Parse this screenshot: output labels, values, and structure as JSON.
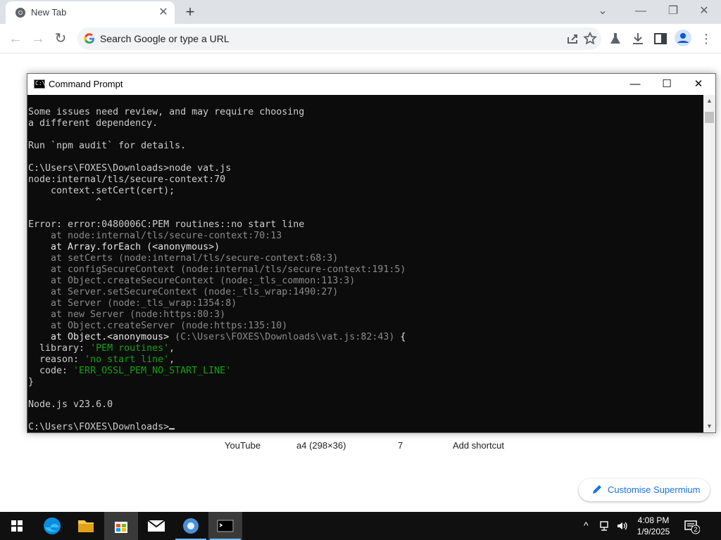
{
  "browser": {
    "tab_title": "New Tab",
    "omnibox_placeholder": "Search Google or type a URL"
  },
  "ntp": {
    "shortcuts": [
      "YouTube",
      "a4 (298×36)",
      "7",
      "Add shortcut"
    ],
    "customise_label": "Customise Supermium"
  },
  "cmd": {
    "title": "Command Prompt",
    "lines": [
      {
        "text": "Some issues need review, and may require choosing",
        "style": "normal"
      },
      {
        "text": "a different dependency.",
        "style": "normal"
      },
      {
        "text": "",
        "style": "normal"
      },
      {
        "text": "Run `npm audit` for details.",
        "style": "normal"
      },
      {
        "text": "",
        "style": "normal"
      },
      {
        "text": "C:\\Users\\FOXES\\Downloads>node vat.js",
        "style": "normal"
      },
      {
        "text": "node:internal/tls/secure-context:70",
        "style": "normal"
      },
      {
        "text": "    context.setCert(cert);",
        "style": "normal"
      },
      {
        "text": "            ^",
        "style": "normal"
      },
      {
        "text": "",
        "style": "normal"
      },
      {
        "text": "Error: error:0480006C:PEM routines::no start line",
        "style": "normal"
      },
      {
        "text": "    at node:internal/tls/secure-context:70:13",
        "style": "gray"
      },
      {
        "text": "    at Array.forEach (<anonymous>)",
        "style": "white"
      },
      {
        "text": "    at setCerts (node:internal/tls/secure-context:68:3)",
        "style": "gray"
      },
      {
        "text": "    at configSecureContext (node:internal/tls/secure-context:191:5)",
        "style": "gray"
      },
      {
        "text": "    at Object.createSecureContext (node:_tls_common:113:3)",
        "style": "gray"
      },
      {
        "text": "    at Server.setSecureContext (node:_tls_wrap:1490:27)",
        "style": "gray"
      },
      {
        "text": "    at Server (node:_tls_wrap:1354:8)",
        "style": "gray"
      },
      {
        "text": "    at new Server (node:https:80:3)",
        "style": "gray"
      },
      {
        "text": "    at Object.createServer (node:https:135:10)",
        "style": "gray"
      },
      {
        "text": "    at Object.<anonymous> (C:\\Users\\FOXES\\Downloads\\vat.js:82:43) {",
        "style": "mixed"
      },
      {
        "text": "  library: 'PEM routines',",
        "style": "kv"
      },
      {
        "text": "  reason: 'no start line',",
        "style": "kv"
      },
      {
        "text": "  code: 'ERR_OSSL_PEM_NO_START_LINE'",
        "style": "kv"
      },
      {
        "text": "}",
        "style": "normal"
      },
      {
        "text": "",
        "style": "normal"
      },
      {
        "text": "Node.js v23.6.0",
        "style": "normal"
      },
      {
        "text": "",
        "style": "normal"
      },
      {
        "text": "C:\\Users\\FOXES\\Downloads>",
        "style": "prompt"
      }
    ]
  },
  "taskbar": {
    "time": "4:08 PM",
    "date": "1/9/2025",
    "notification_count": "2"
  }
}
